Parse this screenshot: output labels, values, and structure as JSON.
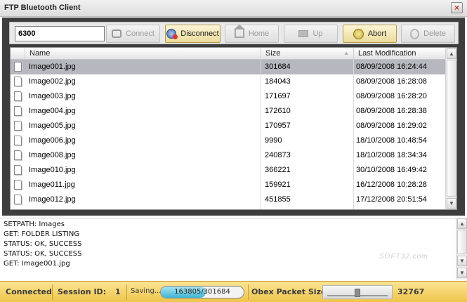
{
  "window": {
    "title": "FTP Bluetooth Client",
    "close_glyph": "×"
  },
  "toolbar": {
    "port_value": "6300",
    "buttons": [
      {
        "label": "Connect",
        "icon": "plug-icon",
        "enabled": false
      },
      {
        "label": "Disconnect",
        "icon": "disconnect-icon",
        "enabled": true
      },
      {
        "label": "Home",
        "icon": "home-icon",
        "enabled": false
      },
      {
        "label": "Up",
        "icon": "up-folder-icon",
        "enabled": false
      },
      {
        "label": "Abort",
        "icon": "abort-icon",
        "enabled": true
      },
      {
        "label": "Delete",
        "icon": "delete-icon",
        "enabled": false
      }
    ]
  },
  "file_list": {
    "columns": {
      "name": "Name",
      "size": "Size",
      "modified": "Last Modification"
    },
    "rows": [
      {
        "name": "Image001.jpg",
        "size": "301684",
        "modified": "08/09/2008 16:24:44",
        "selected": true
      },
      {
        "name": "Image002.jpg",
        "size": "184043",
        "modified": "08/09/2008 16:28:08"
      },
      {
        "name": "Image003.jpg",
        "size": "171697",
        "modified": "08/09/2008 16:28:20"
      },
      {
        "name": "Image004.jpg",
        "size": "172610",
        "modified": "08/09/2008 16:28:38"
      },
      {
        "name": "Image005.jpg",
        "size": "170957",
        "modified": "08/09/2008 16:29:02"
      },
      {
        "name": "Image006.jpg",
        "size": "9990",
        "modified": "18/10/2008 10:48:54"
      },
      {
        "name": "Image008.jpg",
        "size": "240873",
        "modified": "18/10/2008 18:34:34"
      },
      {
        "name": "Image010.jpg",
        "size": "366221",
        "modified": "30/10/2008 16:49:42"
      },
      {
        "name": "Image011.jpg",
        "size": "159921",
        "modified": "16/12/2008 10:28:28"
      },
      {
        "name": "Image012.jpg",
        "size": "451855",
        "modified": "17/12/2008 20:51:54"
      }
    ]
  },
  "log": {
    "lines": [
      "SETPATH: Images",
      "GET: FOLDER LISTING",
      "STATUS: OK, SUCCESS",
      "STATUS: OK, SUCCESS",
      "GET: Image001.jpg"
    ],
    "watermark": "SOFT32.com"
  },
  "status_bar": {
    "connection": "Connected",
    "session_label": "Session ID:",
    "session_id": "1",
    "saving_label": "Saving...",
    "progress_text": "163805/301684",
    "progress_fraction": 0.543,
    "packet_label": "Obex Packet Size:",
    "packet_size": "32767",
    "packet_slider_fraction": 0.5
  },
  "colors": {
    "selected_row": "#b7b7bf",
    "status_bar": "#f5d46a",
    "frame": "#3d3d3d"
  }
}
